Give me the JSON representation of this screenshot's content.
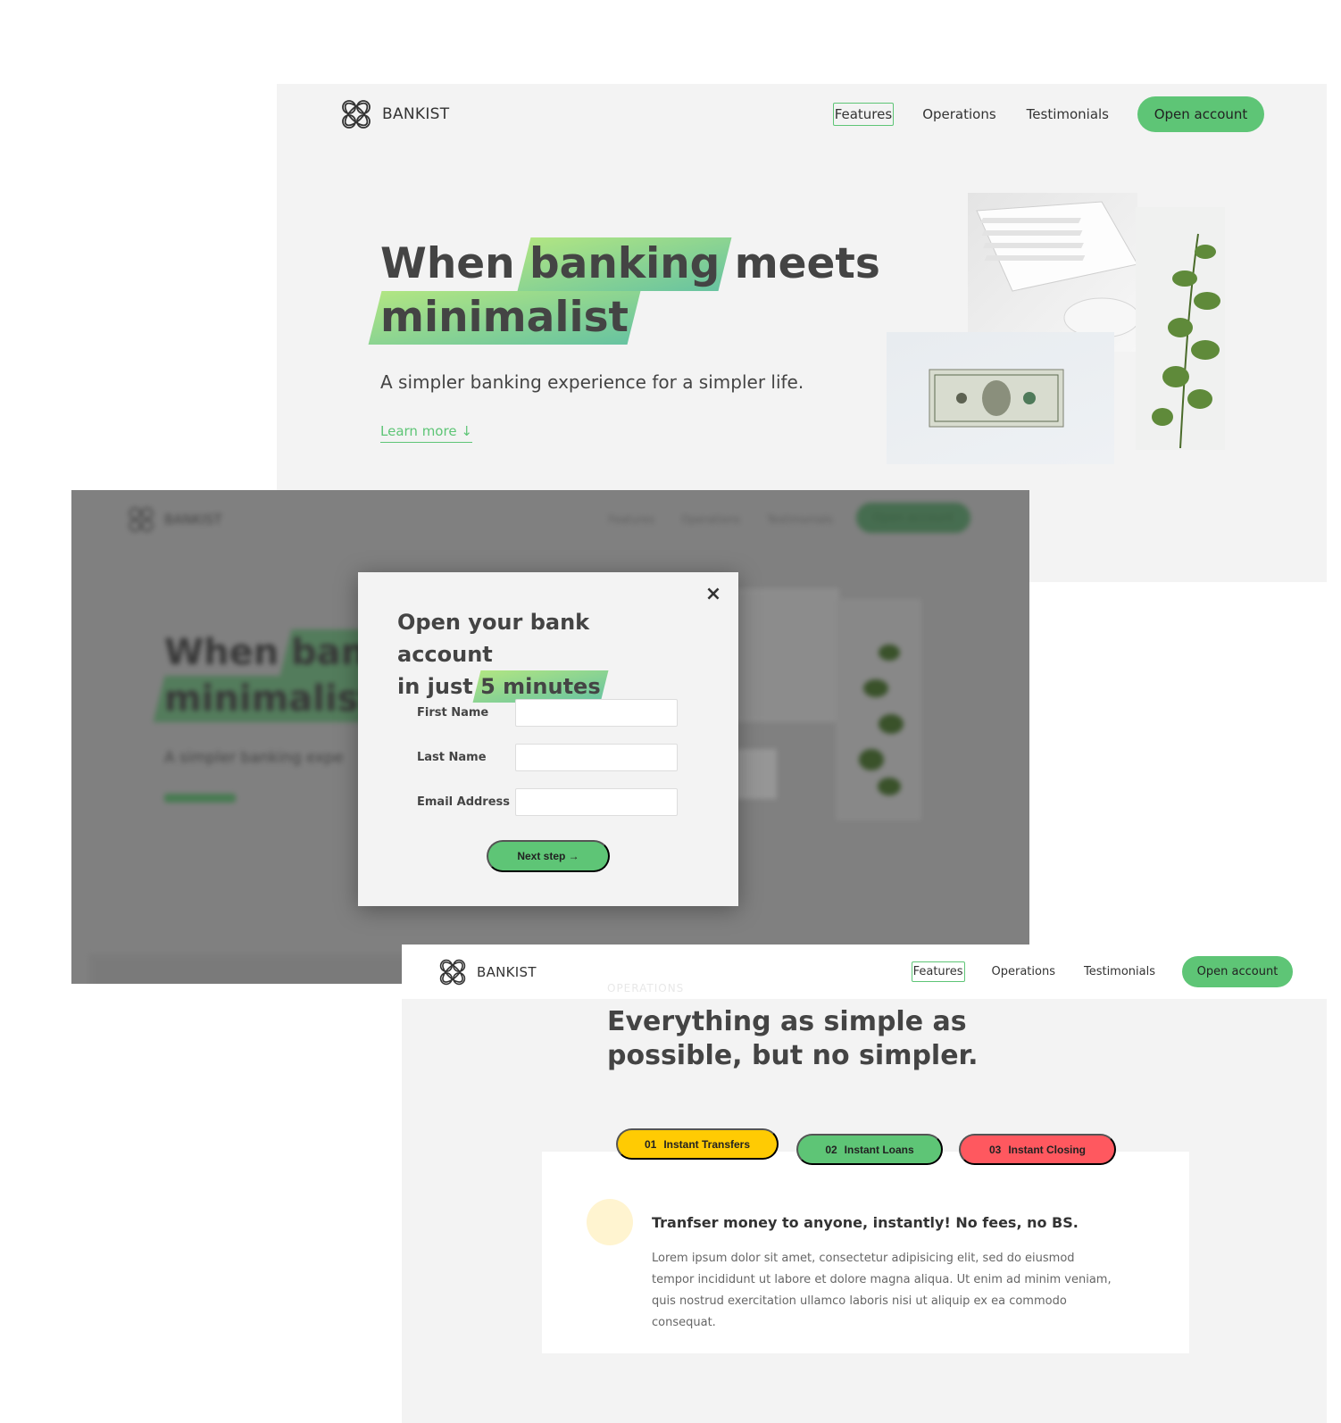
{
  "brand": {
    "name": "BANKIST",
    "accent": "#5ec576",
    "background": "#f3f3f3"
  },
  "hero_panel": {
    "nav": [
      "Features",
      "Operations",
      "Testimonials"
    ],
    "active_nav": "Features",
    "open_account": "Open account",
    "title_word_1": "When",
    "title_highlight_1": "banking",
    "title_word_2": "meets",
    "title_highlight_2": "minimalist",
    "subtitle": "A simpler banking experience for a simpler life.",
    "learn_more": "Learn more ↓",
    "images": [
      "keyboard-image",
      "plant-image",
      "dollar-bill-image"
    ]
  },
  "modal_panel": {
    "bg_blurred": {
      "brand": "BANKIST",
      "nav": [
        "Features",
        "Operations",
        "Testimonials"
      ],
      "open_account": "Open account",
      "title_1": "When",
      "title_hl_1": "ban",
      "title_hl_2": "minimalist",
      "subtitle": "A simpler banking expe",
      "learn_more": "Learn more ↓"
    },
    "modal": {
      "close_icon": "×",
      "title_line_1": "Open your bank account",
      "title_pre": "in just",
      "title_highlight": "5 minutes",
      "fields": [
        {
          "label": "First Name",
          "value": ""
        },
        {
          "label": "Last Name",
          "value": ""
        },
        {
          "label": "Email Address",
          "value": ""
        }
      ],
      "next_button": "Next step →"
    }
  },
  "operations_panel": {
    "nav": [
      "Features",
      "Operations",
      "Testimonials"
    ],
    "active_nav": "Features",
    "open_account": "Open account",
    "section_label": "OPERATIONS",
    "heading": "Everything as simple as possible, but no simpler.",
    "tabs": [
      {
        "num": "01",
        "label": "Instant Transfers",
        "color": "#ffcb03"
      },
      {
        "num": "02",
        "label": "Instant Loans",
        "color": "#5ec576"
      },
      {
        "num": "03",
        "label": "Instant Closing",
        "color": "#ff585f"
      }
    ],
    "content": {
      "title": "Tranfser money to anyone, instantly! No fees, no BS.",
      "text": "Lorem ipsum dolor sit amet, consectetur adipisicing elit, sed do eiusmod tempor incididunt ut labore et dolore magna aliqua. Ut enim ad minim veniam, quis nostrud exercitation ullamco laboris nisi ut aliquip ex ea commodo consequat."
    }
  }
}
